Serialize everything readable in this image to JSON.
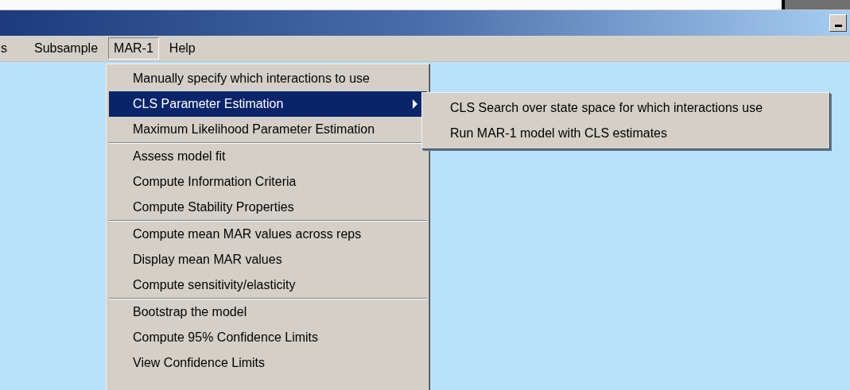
{
  "menubar": {
    "items": [
      {
        "label": "s",
        "selected": false
      },
      {
        "label": "Subsample",
        "selected": false
      },
      {
        "label": "MAR-1",
        "selected": true
      },
      {
        "label": "Help",
        "selected": false
      }
    ]
  },
  "menu": {
    "groups": [
      {
        "items": [
          {
            "label": "Manually specify which interactions to use",
            "selected": false,
            "submenu": false
          },
          {
            "label": "CLS Parameter Estimation",
            "selected": true,
            "submenu": true
          },
          {
            "label": "Maximum Likelihood Parameter Estimation",
            "selected": false,
            "submenu": false
          }
        ]
      },
      {
        "items": [
          {
            "label": "Assess model fit",
            "selected": false,
            "submenu": false
          },
          {
            "label": "Compute Information Criteria",
            "selected": false,
            "submenu": false
          },
          {
            "label": "Compute Stability Properties",
            "selected": false,
            "submenu": false
          }
        ]
      },
      {
        "items": [
          {
            "label": "Compute mean MAR values across reps",
            "selected": false,
            "submenu": false
          },
          {
            "label": "Display mean MAR values",
            "selected": false,
            "submenu": false
          },
          {
            "label": "Compute sensitivity/elasticity",
            "selected": false,
            "submenu": false
          }
        ]
      },
      {
        "items": [
          {
            "label": "Bootstrap the model",
            "selected": false,
            "submenu": false
          },
          {
            "label": "Compute 95% Confidence Limits",
            "selected": false,
            "submenu": false
          },
          {
            "label": "View Confidence Limits",
            "selected": false,
            "submenu": false
          }
        ]
      }
    ]
  },
  "submenu": {
    "items": [
      {
        "label": "CLS Search over state space for which interactions use",
        "selected": false
      },
      {
        "label": "Run MAR-1 model with CLS estimates",
        "selected": false
      }
    ]
  }
}
